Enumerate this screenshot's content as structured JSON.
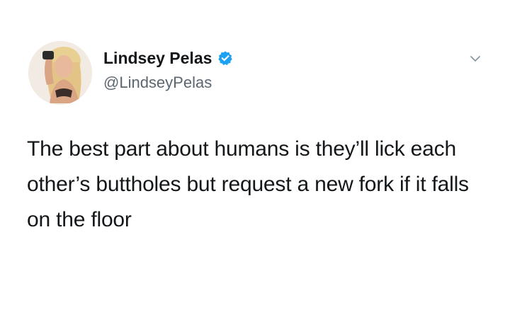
{
  "tweet": {
    "display_name": "Lindsey Pelas",
    "handle": "@LindseyPelas",
    "verified": true,
    "text": "The best part about humans is they’ll lick each other’s buttholes but request a new fork if it falls on the floor",
    "icons": {
      "verified": "verified-badge-icon",
      "menu": "chevron-down-icon"
    },
    "colors": {
      "verified_badge": "#1da1f2",
      "name": "#14171a",
      "handle": "#5b6670",
      "text": "#14171a"
    }
  }
}
